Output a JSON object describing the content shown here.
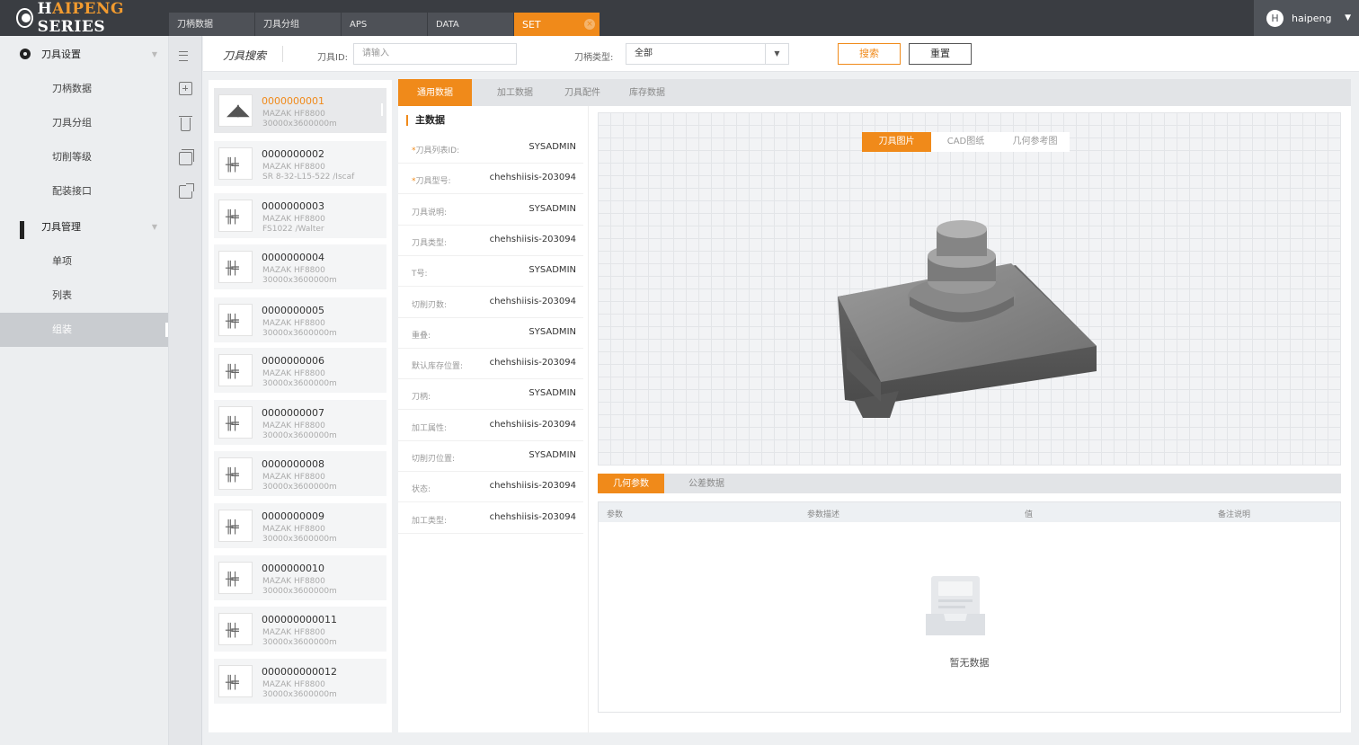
{
  "brand": {
    "prefix": "H",
    "highlight": "AIPENG",
    "suffix": " SERIES"
  },
  "tabs": [
    {
      "label": "刀柄数据",
      "active": false
    },
    {
      "label": "刀具分组",
      "active": false
    },
    {
      "label": "APS",
      "active": false
    },
    {
      "label": "DATA",
      "active": false
    },
    {
      "label": "SET",
      "active": true
    }
  ],
  "user": {
    "initial": "H",
    "name": "haipeng"
  },
  "sidebar": {
    "groups": [
      {
        "label": "刀具设置",
        "icon": "gear-icon",
        "items": [
          "刀柄数据",
          "刀具分组",
          "切削等级",
          "配装接口"
        ]
      },
      {
        "label": "刀具管理",
        "icon": "grid-icon",
        "items": [
          "单项",
          "列表",
          "组装"
        ]
      }
    ],
    "active_item": "组装"
  },
  "search": {
    "title": "刀具搜索",
    "id_label": "刀具ID:",
    "id_placeholder": "请输入",
    "type_label": "刀柄类型:",
    "type_value": "全部",
    "search_btn": "搜索",
    "reset_btn": "重置"
  },
  "tools": [
    {
      "code": "0000000001",
      "line1": "MAZAK HF8800",
      "line2": "30000x3600000m"
    },
    {
      "code": "0000000002",
      "line1": "MAZAK HF8800",
      "line2": "SR 8-32-L15-522 /Iscaf"
    },
    {
      "code": "0000000003",
      "line1": "MAZAK HF8800",
      "line2": "FS1022 /Walter"
    },
    {
      "code": "0000000004",
      "line1": "MAZAK HF8800",
      "line2": "30000x3600000m"
    },
    {
      "code": "0000000005",
      "line1": "MAZAK HF8800",
      "line2": "30000x3600000m"
    },
    {
      "code": "0000000006",
      "line1": "MAZAK HF8800",
      "line2": "30000x3600000m"
    },
    {
      "code": "0000000007",
      "line1": "MAZAK HF8800",
      "line2": "30000x3600000m"
    },
    {
      "code": "0000000008",
      "line1": "MAZAK HF8800",
      "line2": "30000x3600000m"
    },
    {
      "code": "0000000009",
      "line1": "MAZAK HF8800",
      "line2": "30000x3600000m"
    },
    {
      "code": "0000000010",
      "line1": "MAZAK HF8800",
      "line2": "30000x3600000m"
    },
    {
      "code": "000000000011",
      "line1": "MAZAK HF8800",
      "line2": "30000x3600000m"
    },
    {
      "code": "000000000012",
      "line1": "MAZAK HF8800",
      "line2": "30000x3600000m"
    }
  ],
  "content_tabs": [
    "通用数据",
    "加工数据",
    "刀具配件",
    "库存数据"
  ],
  "section_title": "主数据",
  "fields": [
    {
      "label": "刀具列表ID:",
      "value": "SYSADMIN",
      "required": true
    },
    {
      "label": "刀具型号:",
      "value": "chehshiisis-203094",
      "required": true
    },
    {
      "label": "刀具说明:",
      "value": "SYSADMIN",
      "required": false
    },
    {
      "label": "刀具类型:",
      "value": "chehshiisis-203094",
      "required": false
    },
    {
      "label": "T号:",
      "value": "SYSADMIN",
      "required": false
    },
    {
      "label": "切削刃数:",
      "value": "chehshiisis-203094",
      "required": false
    },
    {
      "label": "重叠:",
      "value": "SYSADMIN",
      "required": false
    },
    {
      "label": "默认库存位置:",
      "value": "chehshiisis-203094",
      "required": false
    },
    {
      "label": "刀柄:",
      "value": "SYSADMIN",
      "required": false
    },
    {
      "label": "加工属性:",
      "value": "chehshiisis-203094",
      "required": false
    },
    {
      "label": "切削刃位置:",
      "value": "SYSADMIN",
      "required": false
    },
    {
      "label": "状态:",
      "value": "chehshiisis-203094",
      "required": false
    },
    {
      "label": "加工类型:",
      "value": "chehshiisis-203094",
      "required": false
    }
  ],
  "image_tabs": [
    "刀具图片",
    "CAD图纸",
    "几何参考图"
  ],
  "param_tabs": [
    "几何参数",
    "公差数据"
  ],
  "param_columns": [
    "参数",
    "参数描述",
    "值",
    "备注说明"
  ],
  "empty_text": "暂无数据",
  "colors": {
    "accent": "#f08a1a",
    "topbar": "#3a3d42"
  }
}
